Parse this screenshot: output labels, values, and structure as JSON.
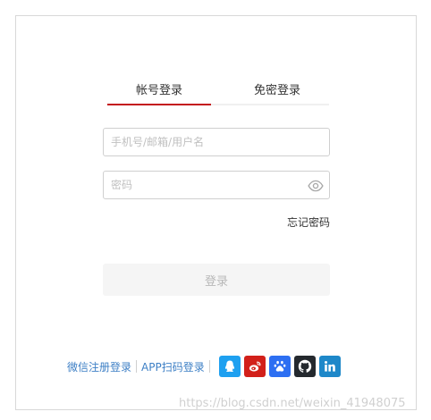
{
  "tabs": {
    "account_label": "帐号登录",
    "sms_label": "免密登录"
  },
  "form": {
    "username_placeholder": "手机号/邮箱/用户名",
    "password_placeholder": "密码",
    "forgot_label": "忘记密码",
    "login_label": "登录"
  },
  "footer": {
    "wechat_label": "微信注册登录",
    "app_label": "APP扫码登录",
    "social_icons": [
      "qq-icon",
      "weibo-icon",
      "baidu-icon",
      "github-icon",
      "linkedin-icon"
    ]
  },
  "watermark": {
    "text": "https://blog.csdn.net/weixin_41948075"
  },
  "colors": {
    "accent": "#c4151c",
    "link": "#3d7fc5",
    "qq": "#1ea0f0",
    "weibo": "#d2201a",
    "baidu": "#2d6ff2",
    "github": "#24292e",
    "linkedin": "#1e88c9"
  }
}
